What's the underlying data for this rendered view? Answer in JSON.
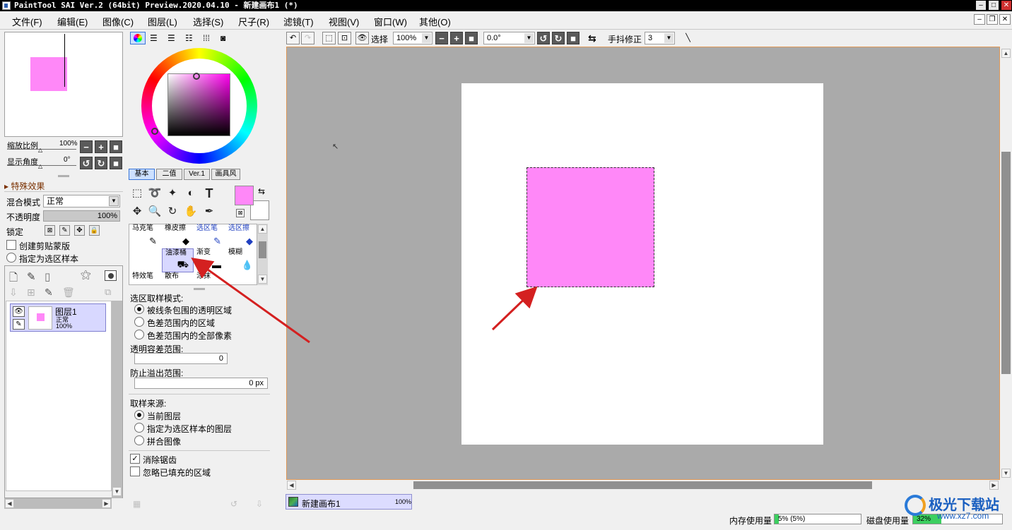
{
  "titlebar": {
    "title": "PaintTool SAI Ver.2 (64bit) Preview.2020.04.10 - 新建画布1 (*)"
  },
  "menu": [
    "文件(F)",
    "编辑(E)",
    "图像(C)",
    "图层(L)",
    "选择(S)",
    "尺子(R)",
    "滤镜(T)",
    "视图(V)",
    "窗口(W)",
    "其他(O)"
  ],
  "navigator": {
    "zoom_label": "缩放比例",
    "zoom_value": "100%",
    "angle_label": "显示角度",
    "angle_value": "0°"
  },
  "layer_props": {
    "effects_label": "特殊效果",
    "blend_label": "混合模式",
    "blend_value": "正常",
    "opacity_label": "不透明度",
    "opacity_value": "100%",
    "lock_label": "锁定",
    "clip_label": "创建剪贴蒙版",
    "sample_label": "指定为选区样本"
  },
  "layers": [
    {
      "name": "图层1",
      "mode": "正常",
      "opacity": "100%"
    }
  ],
  "color_tabs": [
    "基本",
    "二值",
    "Ver.1",
    "画具风"
  ],
  "colors": {
    "primary": "#ff88f8",
    "secondary": "#ffffff",
    "accent": "#3a76d8"
  },
  "brushes": [
    {
      "name": "马克笔",
      "icon": "✎"
    },
    {
      "name": "橡皮擦",
      "icon": "◆"
    },
    {
      "name": "选区笔",
      "icon": "✎"
    },
    {
      "name": "选区擦",
      "icon": "◆"
    },
    {
      "name": "",
      "icon": ""
    },
    {
      "name": "油漆桶",
      "icon": "⛟"
    },
    {
      "name": "渐变",
      "icon": "▬"
    },
    {
      "name": "模糊",
      "icon": "💧"
    },
    {
      "name": "特效笔",
      "icon": ""
    },
    {
      "name": "散布",
      "icon": ""
    },
    {
      "name": "涂抹",
      "icon": ""
    },
    {
      "name": "",
      "icon": ""
    }
  ],
  "tool_options": {
    "mode_label": "选区取样模式:",
    "mode_options": [
      "被线条包围的透明区域",
      "色差范围内的区域",
      "色差范围内的全部像素"
    ],
    "tolerance_label": "透明容差范围:",
    "tolerance_value": "0",
    "overflow_label": "防止溢出范围:",
    "overflow_value": "0 px",
    "source_label": "取样来源:",
    "source_options": [
      "当前图层",
      "指定为选区样本的图层",
      "拼合图像"
    ],
    "antialias_label": "消除锯齿",
    "ignore_label": "忽略已填充的区域"
  },
  "canvas_toolbar": {
    "select_label": "选择",
    "zoom_value": "100%",
    "rotation_value": "0.0°",
    "stabilizer_label": "手抖修正",
    "stabilizer_value": "3"
  },
  "canvas_tab": {
    "name": "新建画布1",
    "zoom": "100%"
  },
  "status": {
    "memory_label": "内存使用量",
    "memory_value": "5% (5%)",
    "memory_fraction": 0.05,
    "disk_label": "磁盘使用量",
    "disk_value": "32%",
    "disk_fraction": 0.32
  },
  "watermark": {
    "text": "极光下载站",
    "url": "www.xz7.com"
  }
}
